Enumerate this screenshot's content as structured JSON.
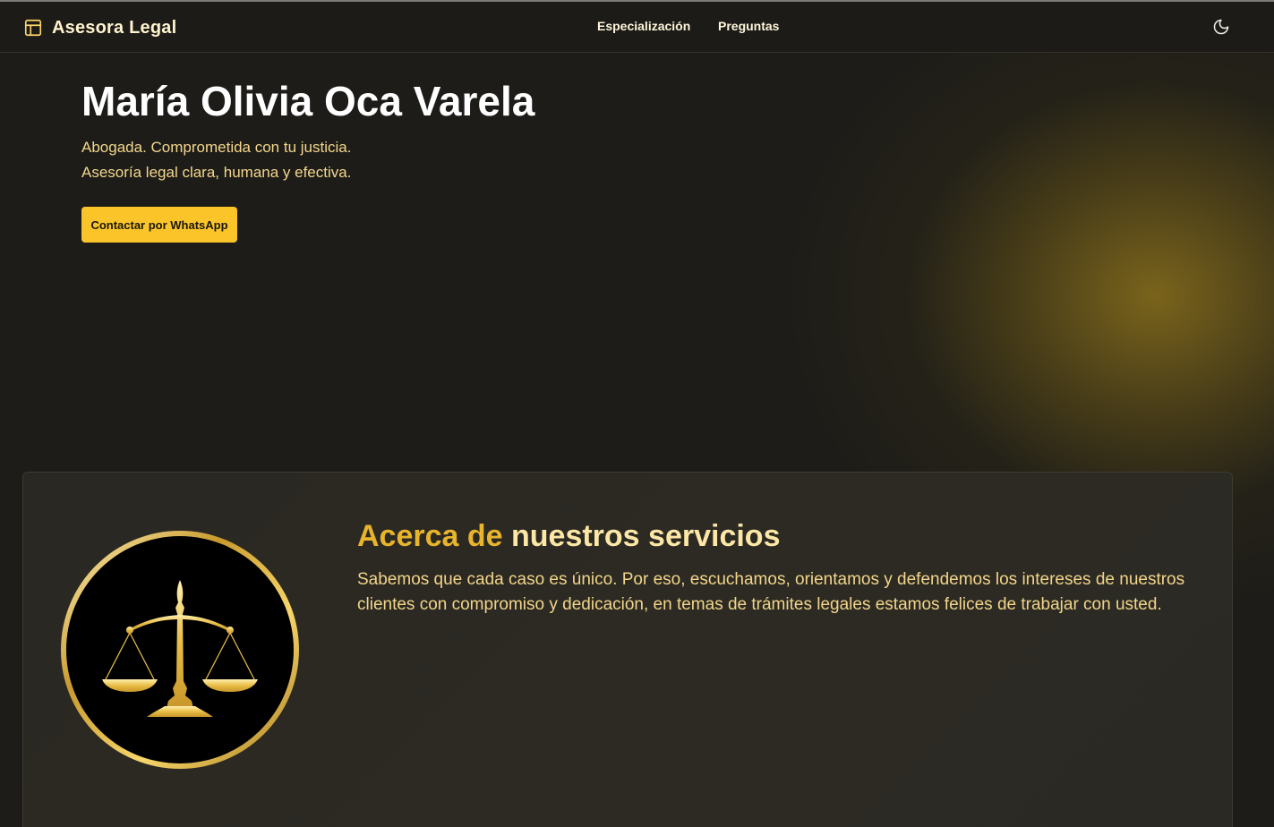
{
  "navbar": {
    "brand": "Asesora Legal",
    "brand_icon": "layout-panel-icon",
    "links": [
      "Especialización",
      "Preguntas"
    ],
    "theme_toggle_icon": "moon-icon"
  },
  "hero": {
    "title": "María Olivia Oca Varela",
    "subtitle_line1": "Abogada. Comprometida con tu justicia.",
    "subtitle_line2": "Asesoría legal clara, humana y efectiva.",
    "cta_label": "Contactar por WhatsApp"
  },
  "about": {
    "title_accent": "Acerca de",
    "title_rest": "nuestros servicios",
    "body": "Sabemos que cada caso es único. Por eso, escuchamos, orientamos y defendemos los intereses de nuestros clientes con compromiso y dedicación, en temas de trámites legales estamos felices de trabajar con usted.",
    "emblem_icon": "scales-of-justice-icon"
  },
  "colors": {
    "background": "#1d1c18",
    "accent": "#fbc52a",
    "gold_text": "#e7b42c",
    "light_gold": "#f2d58a"
  }
}
